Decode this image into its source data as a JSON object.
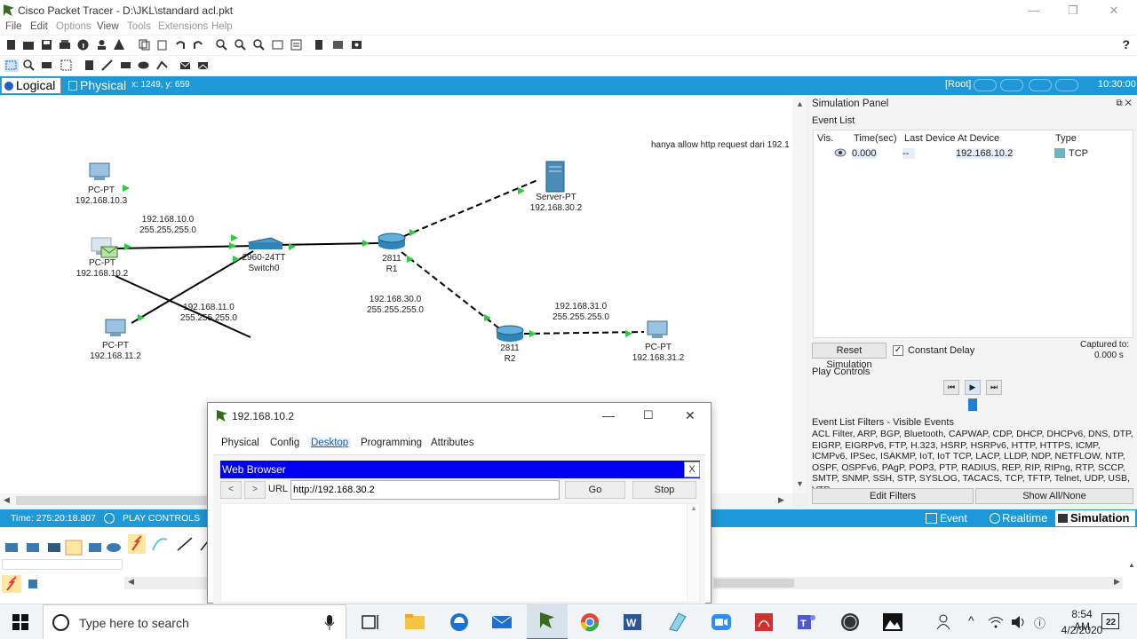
{
  "window": {
    "title": "Cisco Packet Tracer - D:\\JKL\\standard acl.pkt"
  },
  "menu": [
    "File",
    "Edit",
    "Options",
    "View",
    "Tools",
    "Extensions",
    "Help"
  ],
  "modes": {
    "logical": "Logical",
    "physical": "Physical",
    "coords": "x: 1249, y: 659"
  },
  "topright": {
    "root": "[Root]",
    "clock": "10:30:00"
  },
  "network": {
    "note": "hanya allow http request dari 192.1",
    "devices": [
      {
        "name": "PC-PT",
        "ip": "192.168.10.3"
      },
      {
        "name": "PC-PT",
        "ip": "192.168.10.2"
      },
      {
        "name": "PC-PT",
        "ip": "192.168.11.2"
      },
      {
        "name": "2960-24TT",
        "host": "Switch0"
      },
      {
        "name": "2811",
        "host": "R1"
      },
      {
        "name": "2811",
        "host": "R2"
      },
      {
        "name": "Server-PT",
        "ip": "192.168.30.2"
      },
      {
        "name": "PC-PT",
        "ip": "192.168.31.2"
      }
    ],
    "subnets": [
      {
        "net": "192.168.10.0",
        "mask": "255.255.255.0"
      },
      {
        "net": "192.168.11.0",
        "mask": "255.255.255.0"
      },
      {
        "net": "192.168.30.0",
        "mask": "255.255.255.0"
      },
      {
        "net": "192.168.31.0",
        "mask": "255.255.255.0"
      }
    ]
  },
  "simulation": {
    "title": "Simulation Panel",
    "event_list_label": "Event List",
    "columns": [
      "Vis.",
      "Time(sec)",
      "Last Device",
      "At Device",
      "Type"
    ],
    "rows": [
      {
        "time": "0.000",
        "last": "--",
        "at": "192.168.10.2",
        "type": "TCP"
      }
    ],
    "reset_label": "Reset Simulation",
    "constant_delay": "Constant Delay",
    "captured_label": "Captured to:",
    "captured_value": "0.000 s",
    "play_controls": "Play Controls",
    "filters_title": "Event List Filters - Visible Events",
    "filters_text": "ACL Filter, ARP, BGP, Bluetooth, CAPWAP, CDP, DHCP, DHCPv6, DNS, DTP, EIGRP, EIGRPv6, FTP, H.323, HSRP, HSRPv6, HTTP, HTTPS, ICMP, ICMPv6, IPSec, ISAKMP, IoT, IoT TCP, LACP, LLDP, NDP, NETFLOW, NTP, OSPF, OSPFv6, PAgP, POP3, PTP, RADIUS, REP, RIP, RIPng, RTP, SCCP, SMTP, SNMP, SSH, STP, SYSLOG, TACACS, TCP, TFTP, Telnet, UDP, USB, VTP",
    "edit_filters": "Edit Filters",
    "show_all": "Show All/None",
    "type_color": "#6bb5c2"
  },
  "statusbar": {
    "time": "Time: 275:20:18.807",
    "play": "PLAY CONTROLS",
    "event_list": "Event List",
    "realtime": "Realtime",
    "simulation": "Simulation"
  },
  "dialog": {
    "title": "192.168.10.2",
    "tabs": [
      "Physical",
      "Config",
      "Desktop",
      "Programming",
      "Attributes"
    ],
    "browser_title": "Web Browser",
    "close_x": "X",
    "back": "<",
    "forward": ">",
    "url_label": "URL",
    "url_value": "http://192.168.30.2",
    "go": "Go",
    "stop": "Stop"
  },
  "taskbar": {
    "search_placeholder": "Type here to search",
    "time": "8:54 AM",
    "date": "4/2/2020",
    "notif": "22"
  },
  "colors": {
    "accent": "#1e98d6",
    "browser_bar": "#0000f0",
    "link_green": "#2ecc40"
  }
}
